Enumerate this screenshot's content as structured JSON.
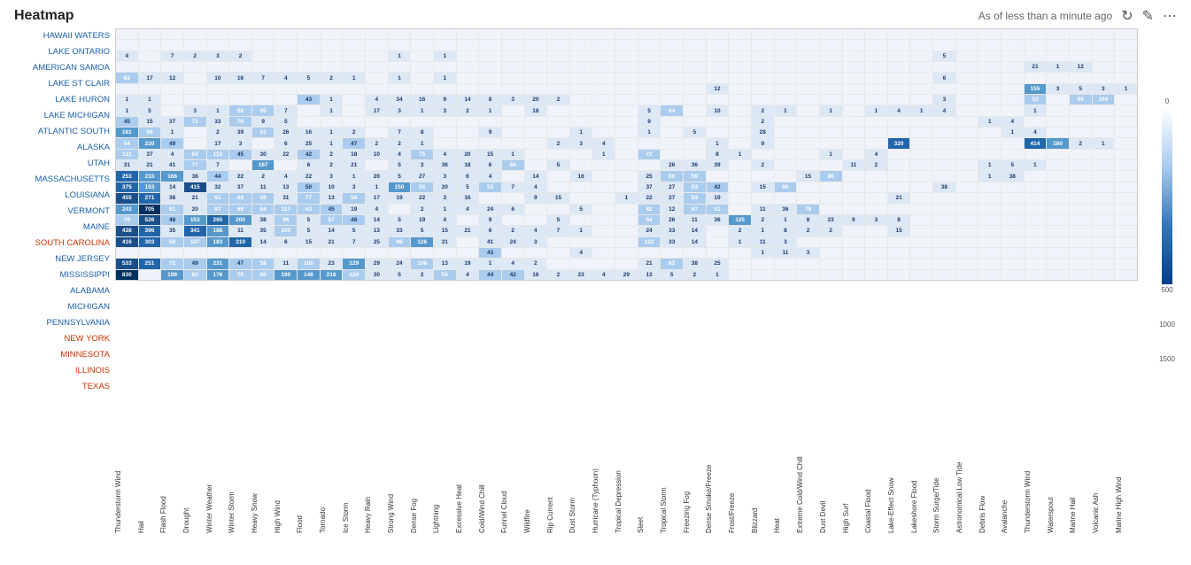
{
  "header": {
    "title": "Heatmap",
    "status": "As of less than a minute ago",
    "refresh_icon": "↻",
    "edit_icon": "✎",
    "more_icon": "⋯"
  },
  "legend": {
    "labels": [
      "0",
      "500",
      "1000",
      "1500"
    ]
  },
  "y_labels": [
    "HAWAII WATERS",
    "LAKE ONTARIO",
    "AMERICAN SAMOA",
    "LAKE ST CLAIR",
    "LAKE HURON",
    "LAKE MICHIGAN",
    "ATLANTIC SOUTH",
    "ALASKA",
    "UTAH",
    "MASSACHUSETTS",
    "LOUISIANA",
    "VERMONT",
    "MAINE",
    "SOUTH CAROLINA",
    "NEW JERSEY",
    "MISSISSIPPI",
    "ALABAMA",
    "MICHIGAN",
    "PENNSYLVANIA",
    "NEW YORK",
    "MINNESOTA",
    "ILLINOIS",
    "TEXAS"
  ],
  "x_labels": [
    "Thunderstorm Wind",
    "Hail",
    "Flash Flood",
    "Drought",
    "Winter Weather",
    "Winter Storm",
    "Heavy Snow",
    "High Wind",
    "Flood",
    "Tornado",
    "Ice Storm",
    "Heavy Rain",
    "Strong Wind",
    "Dense Fog",
    "Lightning",
    "Excessive Heat",
    "Cold/Wind Chill",
    "Funnel Cloud",
    "Wildfire",
    "Rip Current",
    "Dust Storm",
    "Hurricane (Typhoon)",
    "Tropical Depression",
    "Sleet",
    "Tropical Storm",
    "Freezing Fog",
    "Dense Smoke/Freeze",
    "Frost/Freeze",
    "Blizzard",
    "Heat",
    "Extreme Cold/Wind Chill",
    "Dust Devil",
    "High Surf",
    "Coastal Flood",
    "Lake-Effect Snow",
    "Lakeshore Flood",
    "Storm Surge/Tide",
    "Astronomical Low Tide",
    "Debris Flow",
    "Avalanche",
    "Thunderstorm Wind",
    "Waterspout",
    "Marine Hail",
    "Volcanic Ash",
    "Marine High Wind"
  ],
  "rows": [
    {
      "label": "HAWAII WATERS",
      "cells": [
        0,
        0,
        0,
        0,
        0,
        0,
        0,
        0,
        0,
        0,
        0,
        0,
        0,
        0,
        0,
        0,
        0,
        0,
        0,
        0,
        0,
        0,
        0,
        0,
        0,
        0,
        0,
        0,
        0,
        0,
        0,
        0,
        0,
        0,
        0,
        0,
        0,
        0,
        0,
        0,
        0,
        0,
        0,
        0,
        0
      ]
    },
    {
      "label": "LAKE ONTARIO",
      "cells": [
        0,
        0,
        0,
        0,
        0,
        0,
        0,
        0,
        0,
        0,
        0,
        0,
        0,
        0,
        0,
        0,
        0,
        0,
        0,
        0,
        0,
        0,
        0,
        0,
        0,
        0,
        0,
        0,
        0,
        0,
        0,
        0,
        0,
        0,
        0,
        0,
        0,
        0,
        0,
        0,
        0,
        0,
        0,
        0,
        0
      ]
    },
    {
      "label": "AMERICAN SAMOA",
      "cells": [
        4,
        0,
        7,
        2,
        3,
        2,
        0,
        0,
        0,
        0,
        0,
        0,
        1,
        0,
        1,
        0,
        0,
        0,
        0,
        0,
        0,
        0,
        0,
        0,
        0,
        0,
        0,
        0,
        0,
        0,
        0,
        0,
        0,
        0,
        0,
        0,
        5,
        0,
        0,
        0,
        0,
        0,
        0,
        0,
        0
      ]
    },
    {
      "label": "LAKE ST CLAIR",
      "cells": [
        0,
        0,
        0,
        0,
        0,
        0,
        0,
        0,
        0,
        0,
        0,
        0,
        0,
        0,
        0,
        0,
        0,
        0,
        0,
        0,
        0,
        0,
        0,
        0,
        0,
        0,
        0,
        0,
        0,
        0,
        0,
        0,
        0,
        0,
        0,
        0,
        0,
        0,
        0,
        0,
        21,
        1,
        12,
        0,
        0
      ]
    },
    {
      "label": "LAKE HURON",
      "cells": [
        63,
        17,
        12,
        0,
        10,
        16,
        7,
        4,
        5,
        2,
        1,
        0,
        1,
        0,
        1,
        0,
        0,
        0,
        0,
        0,
        0,
        0,
        0,
        0,
        0,
        0,
        0,
        0,
        0,
        0,
        0,
        0,
        0,
        0,
        0,
        0,
        6,
        0,
        0,
        0,
        0,
        0,
        0,
        0,
        0
      ]
    },
    {
      "label": "LAKE MICHIGAN",
      "cells": [
        0,
        0,
        0,
        0,
        0,
        0,
        0,
        0,
        0,
        0,
        0,
        0,
        0,
        0,
        0,
        0,
        0,
        0,
        0,
        0,
        0,
        0,
        0,
        0,
        0,
        0,
        12,
        0,
        0,
        0,
        0,
        0,
        0,
        0,
        0,
        0,
        0,
        0,
        0,
        0,
        155,
        3,
        5,
        3,
        1
      ]
    },
    {
      "label": "ATLANTIC SOUTH",
      "cells": [
        1,
        1,
        0,
        0,
        0,
        0,
        0,
        0,
        43,
        1,
        0,
        4,
        34,
        16,
        9,
        14,
        8,
        3,
        20,
        2,
        0,
        0,
        0,
        0,
        0,
        0,
        0,
        0,
        0,
        0,
        0,
        0,
        0,
        0,
        0,
        0,
        3,
        0,
        0,
        0,
        53,
        0,
        89,
        104,
        0
      ]
    },
    {
      "label": "ALASKA",
      "cells": [
        1,
        5,
        0,
        3,
        1,
        58,
        95,
        7,
        0,
        1,
        0,
        17,
        3,
        1,
        3,
        2,
        1,
        0,
        18,
        0,
        0,
        0,
        0,
        5,
        64,
        0,
        10,
        0,
        2,
        1,
        0,
        1,
        0,
        1,
        4,
        1,
        4,
        0,
        0,
        0,
        1,
        0,
        0,
        0,
        0
      ]
    },
    {
      "label": "UTAH",
      "cells": [
        45,
        15,
        37,
        72,
        33,
        70,
        9,
        5,
        0,
        0,
        0,
        0,
        0,
        0,
        0,
        0,
        0,
        0,
        0,
        0,
        0,
        0,
        0,
        9,
        0,
        0,
        0,
        0,
        2,
        0,
        0,
        0,
        0,
        0,
        0,
        0,
        0,
        0,
        1,
        4,
        0,
        0,
        0,
        0,
        0
      ]
    },
    {
      "label": "MASSACHUSETTS",
      "cells": [
        161,
        59,
        1,
        0,
        2,
        39,
        52,
        26,
        16,
        1,
        2,
        0,
        7,
        8,
        0,
        0,
        9,
        0,
        0,
        0,
        1,
        0,
        0,
        1,
        0,
        5,
        0,
        0,
        28,
        0,
        0,
        0,
        0,
        0,
        0,
        0,
        0,
        0,
        0,
        1,
        4,
        0,
        0,
        0,
        0
      ]
    },
    {
      "label": "LOUISIANA",
      "cells": [
        54,
        220,
        49,
        0,
        17,
        3,
        0,
        6,
        25,
        1,
        47,
        2,
        2,
        1,
        0,
        0,
        0,
        0,
        0,
        2,
        3,
        4,
        0,
        0,
        0,
        0,
        1,
        0,
        9,
        0,
        0,
        0,
        0,
        0,
        320,
        0,
        0,
        0,
        0,
        0,
        414,
        160,
        2,
        1,
        0
      ]
    },
    {
      "label": "VERMONT",
      "cells": [
        121,
        37,
        4,
        54,
        110,
        45,
        30,
        22,
        42,
        2,
        18,
        10,
        4,
        75,
        4,
        20,
        15,
        1,
        0,
        0,
        0,
        1,
        0,
        72,
        0,
        0,
        8,
        1,
        0,
        0,
        0,
        1,
        0,
        4,
        0,
        0,
        0,
        0,
        0,
        0,
        0,
        0,
        0,
        0,
        0
      ]
    },
    {
      "label": "MAINE",
      "cells": [
        31,
        21,
        41,
        77,
        7,
        0,
        167,
        0,
        6,
        2,
        21,
        0,
        5,
        3,
        36,
        18,
        6,
        66,
        0,
        5,
        0,
        0,
        0,
        0,
        26,
        36,
        39,
        0,
        2,
        0,
        0,
        0,
        11,
        2,
        0,
        0,
        0,
        0,
        1,
        5,
        1,
        0,
        0,
        0,
        0
      ]
    },
    {
      "label": "SOUTH CAROLINA",
      "cells": [
        253,
        233,
        166,
        36,
        44,
        22,
        2,
        4,
        22,
        3,
        1,
        20,
        5,
        27,
        3,
        6,
        4,
        0,
        14,
        0,
        16,
        0,
        0,
        25,
        80,
        59,
        0,
        0,
        0,
        0,
        15,
        86,
        0,
        0,
        0,
        0,
        0,
        0,
        1,
        38,
        0,
        0,
        0,
        0,
        0
      ]
    },
    {
      "label": "NEW JERSEY",
      "cells": [
        375,
        153,
        14,
        415,
        32,
        37,
        11,
        13,
        50,
        10,
        3,
        1,
        150,
        55,
        20,
        5,
        53,
        7,
        4,
        0,
        0,
        0,
        0,
        37,
        27,
        53,
        42,
        0,
        15,
        86,
        0,
        0,
        0,
        0,
        0,
        0,
        38,
        0,
        0,
        0,
        0,
        0,
        0,
        0,
        0
      ]
    },
    {
      "label": "MISSISSIPPI",
      "cells": [
        455,
        271,
        38,
        21,
        61,
        63,
        58,
        31,
        77,
        13,
        56,
        17,
        19,
        22,
        3,
        16,
        0,
        0,
        9,
        15,
        0,
        0,
        1,
        22,
        27,
        53,
        19,
        0,
        0,
        0,
        0,
        0,
        0,
        0,
        21,
        0,
        0,
        0,
        0,
        0,
        0,
        0,
        0,
        0,
        0
      ]
    },
    {
      "label": "ALABAMA",
      "cells": [
        243,
        705,
        61,
        20,
        87,
        69,
        64,
        117,
        63,
        45,
        19,
        4,
        0,
        2,
        1,
        4,
        24,
        6,
        0,
        0,
        5,
        0,
        0,
        82,
        12,
        67,
        51,
        0,
        11,
        36,
        79,
        0,
        0,
        0,
        0,
        0,
        0,
        0,
        0,
        0,
        0,
        0,
        0,
        0,
        0
      ]
    },
    {
      "label": "MICHIGAN",
      "cells": [
        79,
        526,
        48,
        153,
        265,
        200,
        38,
        98,
        5,
        57,
        48,
        14,
        5,
        19,
        4,
        0,
        9,
        0,
        0,
        5,
        0,
        0,
        0,
        54,
        26,
        11,
        36,
        125,
        2,
        1,
        8,
        23,
        9,
        3,
        8,
        0,
        0,
        0,
        0,
        0,
        0,
        0,
        0,
        0,
        0
      ]
    },
    {
      "label": "PENNSYLVANIA",
      "cells": [
        438,
        396,
        35,
        341,
        188,
        11,
        35,
        100,
        5,
        14,
        5,
        13,
        33,
        5,
        15,
        21,
        6,
        2,
        4,
        7,
        1,
        0,
        0,
        24,
        33,
        14,
        0,
        2,
        1,
        8,
        2,
        2,
        0,
        0,
        15,
        0,
        0,
        0,
        0,
        0,
        0,
        0,
        0,
        0,
        0
      ]
    },
    {
      "label": "NEW YORK",
      "cells": [
        416,
        303,
        58,
        107,
        183,
        310,
        14,
        6,
        15,
        21,
        7,
        25,
        98,
        126,
        31,
        0,
        41,
        24,
        3,
        0,
        0,
        0,
        0,
        122,
        33,
        14,
        0,
        1,
        11,
        3,
        0,
        0,
        0,
        0,
        0,
        0,
        0,
        0,
        0,
        0,
        0,
        0,
        0,
        0,
        0
      ]
    },
    {
      "label": "MINNESOTA",
      "cells": [
        0,
        0,
        0,
        0,
        0,
        0,
        0,
        0,
        0,
        0,
        0,
        0,
        0,
        0,
        0,
        0,
        43,
        0,
        0,
        0,
        4,
        0,
        0,
        0,
        0,
        0,
        0,
        0,
        1,
        11,
        3,
        0,
        0,
        0,
        0,
        0,
        0,
        0,
        0,
        0,
        0,
        0,
        0,
        0,
        0
      ]
    },
    {
      "label": "ILLINOIS",
      "cells": [
        533,
        251,
        72,
        49,
        231,
        47,
        58,
        11,
        100,
        23,
        129,
        29,
        24,
        108,
        13,
        19,
        1,
        4,
        2,
        0,
        0,
        0,
        0,
        21,
        62,
        38,
        25,
        0,
        0,
        0,
        0,
        0,
        0,
        0,
        0,
        0,
        0,
        0,
        0,
        0,
        0,
        0,
        0,
        0,
        0
      ]
    },
    {
      "label": "TEXAS",
      "cells": [
        830,
        0,
        199,
        62,
        176,
        75,
        80,
        190,
        146,
        216,
        124,
        30,
        5,
        2,
        55,
        4,
        44,
        42,
        16,
        2,
        23,
        4,
        29,
        13,
        5,
        2,
        1,
        0,
        0,
        0,
        0,
        0,
        0,
        0,
        0,
        0,
        0,
        0,
        0,
        0,
        0,
        0,
        0,
        0,
        0
      ]
    }
  ]
}
